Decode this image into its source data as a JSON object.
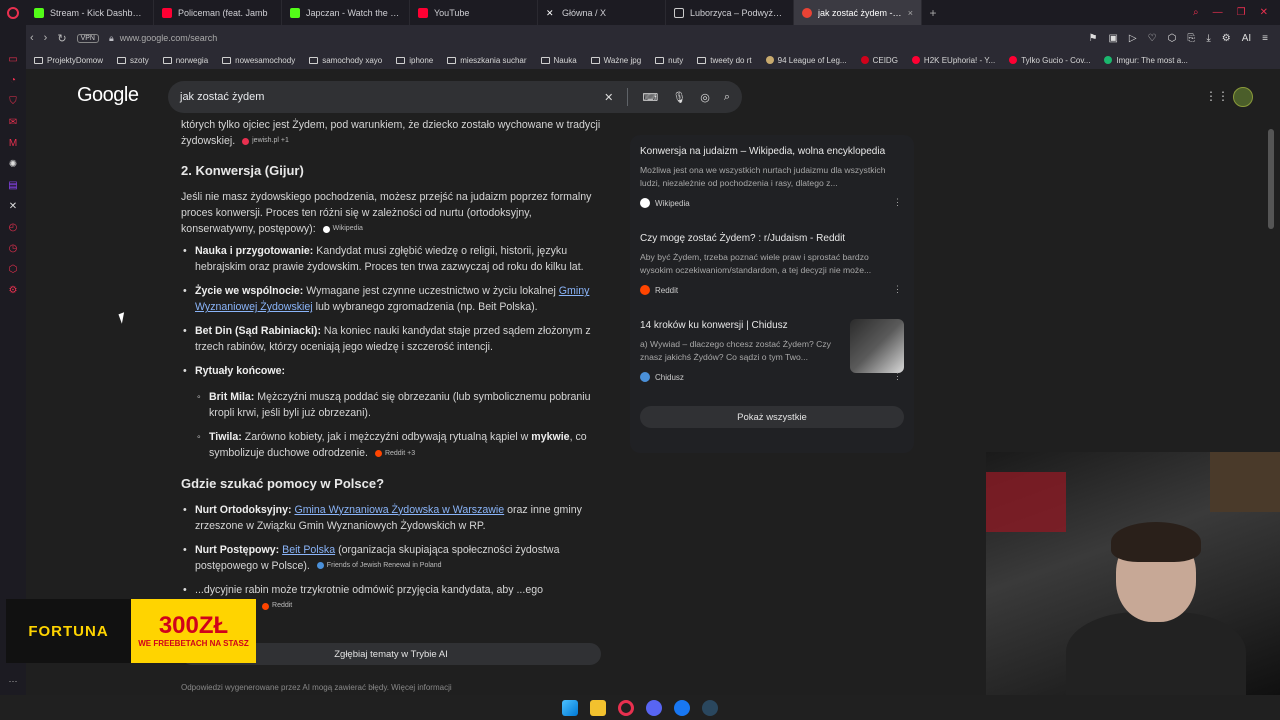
{
  "tabs": [
    {
      "label": "Stream - Kick Dashboard",
      "color": "#53fc18"
    },
    {
      "label": "Policeman (feat. Jamb",
      "color": "#ff0033"
    },
    {
      "label": "Japczan - Watch the VOD",
      "color": "#53fc18"
    },
    {
      "label": "YouTube",
      "color": "#ff0033"
    },
    {
      "label": "Główna / X",
      "color": "#ffffff"
    },
    {
      "label": "Luborzyca – Podwyższen",
      "color": "#cccccc"
    },
    {
      "label": "jak zostać żydem - Szukaj",
      "color": "#ea4335",
      "active": true
    }
  ],
  "address": {
    "vpn": "VPN",
    "url": "www.google.com/search",
    "ai_label": "AI"
  },
  "bookmarks": [
    {
      "label": "ProjektyDomow",
      "type": "folder"
    },
    {
      "label": "szoty",
      "type": "folder"
    },
    {
      "label": "norwegia",
      "type": "folder"
    },
    {
      "label": "nowesamochody",
      "type": "folder"
    },
    {
      "label": "samochody xayo",
      "type": "folder"
    },
    {
      "label": "iphone",
      "type": "folder"
    },
    {
      "label": "mieszkania suchar",
      "type": "folder"
    },
    {
      "label": "Nauka",
      "type": "folder"
    },
    {
      "label": "Ważne jpg",
      "type": "folder"
    },
    {
      "label": "nuty",
      "type": "folder"
    },
    {
      "label": "tweety do rt",
      "type": "folder"
    },
    {
      "label": "94 League of Leg...",
      "type": "site",
      "color": "#c8aa6e"
    },
    {
      "label": "CEIDG",
      "type": "site",
      "color": "#d0021b"
    },
    {
      "label": "H2K EUphoria! - Y...",
      "type": "site",
      "color": "#ff0033"
    },
    {
      "label": "Tylko Gucio - Cov...",
      "type": "site",
      "color": "#ff0033"
    },
    {
      "label": "Imgur: The most a...",
      "type": "site",
      "color": "#1bb76e"
    }
  ],
  "google": {
    "logo": "Google",
    "query": "jak zostać żydem"
  },
  "content": {
    "intro_text": "których tylko ojciec jest Żydem, pod warunkiem, że dziecko zostało wychowane w tradycji żydowskiej.",
    "intro_cite": "jewish.pl +1",
    "section2_title": "2. Konwersja (Gijur)",
    "section2_text": "Jeśli nie masz żydowskiego pochodzenia, możesz przejść na judaizm poprzez formalny proces konwersji. Proces ten różni się w zależności od nurtu (ortodoksyjny, konserwatywny, postępowy):",
    "section2_cite": "Wikipedia",
    "items": {
      "nauka_title": "Nauka i przygotowanie:",
      "nauka_text": " Kandydat musi zgłębić wiedzę o religii, historii, języku hebrajskim oraz prawie żydowskim. Proces ten trwa zazwyczaj od roku do kilku lat.",
      "zycie_title": "Życie we wspólnocie:",
      "zycie_text": " Wymagane jest czynne uczestnictwo w życiu lokalnej ",
      "zycie_link": "Gminy Wyznaniowej Żydowskiej",
      "zycie_text2": " lub wybranego zgromadzenia (np. Beit Polska).",
      "betdin_title": "Bet Din (Sąd Rabiniacki):",
      "betdin_text": " Na koniec nauki kandydat staje przed sądem złożonym z trzech rabinów, którzy oceniają jego wiedzę i szczerość intencji.",
      "rytualy_title": "Rytuały końcowe:",
      "brit_title": "Brit Mila:",
      "brit_text": " Mężczyźni muszą poddać się obrzezaniu (lub symbolicznemu pobraniu kropli krwi, jeśli byli już obrzezani).",
      "tiwila_title": "Tiwila:",
      "tiwila_text1": " Zarówno kobiety, jak i mężczyźni odbywają rytualną kąpiel w ",
      "tiwila_bold": "mykwie",
      "tiwila_text2": ", co symbolizuje duchowe odrodzenie.",
      "tiwila_cite": "Reddit +3"
    },
    "section3_title": "Gdzie szukać pomocy w Polsce?",
    "help": {
      "orto_title": "Nurt Ortodoksyjny:",
      "orto_link": "Gmina Wyznaniowa Żydowska w Warszawie",
      "orto_text": " oraz inne gminy zrzeszone w Związku Gmin Wyznaniowych Żydowskich w RP.",
      "post_title": "Nurt Postępowy:",
      "post_link": "Beit Polska",
      "post_text": " (organizacja skupiająca społeczności żydostwa postępowego w Polsce).",
      "post_cite": "Friends of Jewish Renewal in Poland",
      "last_text": "...dycyjnie rabin może trzykrotnie odmówić przyjęcia kandydata, aby ...ego determinacji.",
      "last_cite": "Reddit"
    },
    "deepen_label": "Zgłębiaj tematy w Trybie AI",
    "footer_note": "Odpowiedzi wygenerowane przez AI mogą zawierać błędy. Więcej informacji"
  },
  "sources": [
    {
      "title": "Konwersja na judaizm – Wikipedia, wolna encyklopedia",
      "desc": "Możliwa jest ona we wszystkich nurtach judaizmu dla wszystkich ludzi, niezależnie od pochodzenia i rasy, dlatego z...",
      "site": "Wikipedia",
      "color": "#ffffff"
    },
    {
      "title": "Czy mogę zostać Żydem? : r/Judaism - Reddit",
      "desc": "Aby być Żydem, trzeba poznać wiele praw i sprostać bardzo wysokim oczekiwaniom/standardom, a tej decyzji nie może...",
      "site": "Reddit",
      "color": "#ff4500"
    },
    {
      "title": "14 kroków ku konwersji | Chidusz",
      "desc": "a) Wywiad – dlaczego chcesz zostać Żydem? Czy znasz jakichś Żydów? Co sądzi o tym Two...",
      "site": "Chidusz",
      "color": "#4a90d9"
    }
  ],
  "show_all_label": "Pokaż wszystkie",
  "ad": {
    "brand": "FORTUNA",
    "amount": "300ZŁ",
    "offer": "WE FREEBETACH NA STASZ"
  }
}
